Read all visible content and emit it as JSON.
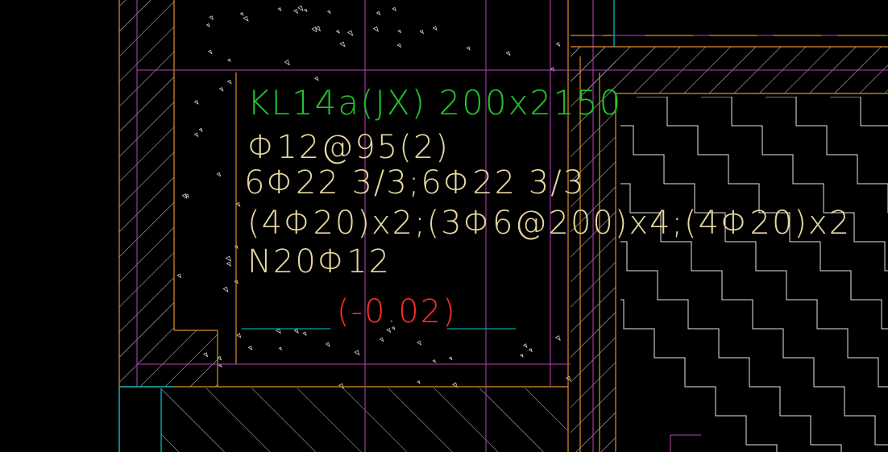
{
  "beam_label": {
    "name": "KL14a(JX) 200x2150",
    "stirrup": "Φ12@95(2)",
    "top_bottom_bars": "6Φ22 3/3;6Φ22 3/3",
    "haunch_bars": "(4Φ20)x2;(3Φ6@200)x4;(4Φ20)x2",
    "side_bars": "N20Φ12",
    "elevation": "(-0.02)"
  },
  "colors": {
    "background": "#000000",
    "beam_name": "#22c22c",
    "rebar_text": "#e8d8a0",
    "elevation": "#ff2a2a",
    "wall_outline": "#e0902a",
    "gridline": "#c040c0",
    "cyan_line": "#00c8d8",
    "hatch": "#d8d8d8"
  }
}
